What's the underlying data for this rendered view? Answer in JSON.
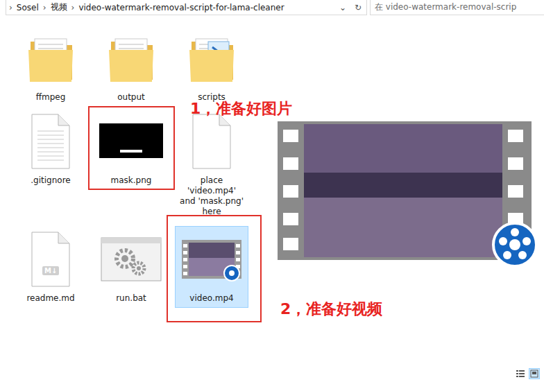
{
  "address_bar": {
    "separator": "›",
    "crumbs": [
      "Sosel",
      "视频",
      "video-watermark-removal-script-for-lama-cleaner"
    ],
    "dropdown": "⌄",
    "refresh": "↻"
  },
  "search": {
    "placeholder": "在 video-watermark-removal-scrip"
  },
  "files": [
    {
      "name": "ffmpeg",
      "kind": "folder",
      "selected": false
    },
    {
      "name": "output",
      "kind": "folder",
      "selected": false
    },
    {
      "name": "scripts",
      "kind": "scriptfolder",
      "selected": false
    },
    {
      "name": ".gitignore",
      "kind": "textfile",
      "selected": false
    },
    {
      "name": "mask.png",
      "kind": "image",
      "selected": false
    },
    {
      "name": "place 'video.mp4' and 'mask.png' here",
      "kind": "blankfile",
      "selected": false
    },
    {
      "name": "readme.md",
      "kind": "markdown",
      "selected": false,
      "badge": "M↓"
    },
    {
      "name": "run.bat",
      "kind": "batch",
      "selected": false
    },
    {
      "name": "video.mp4",
      "kind": "video",
      "selected": true
    }
  ],
  "annotations": [
    {
      "label": "1，准备好图片"
    },
    {
      "label": "2，准备好视频"
    }
  ],
  "status_bar": {
    "view_buttons": [
      {
        "selected": false
      },
      {
        "selected": true
      }
    ]
  }
}
